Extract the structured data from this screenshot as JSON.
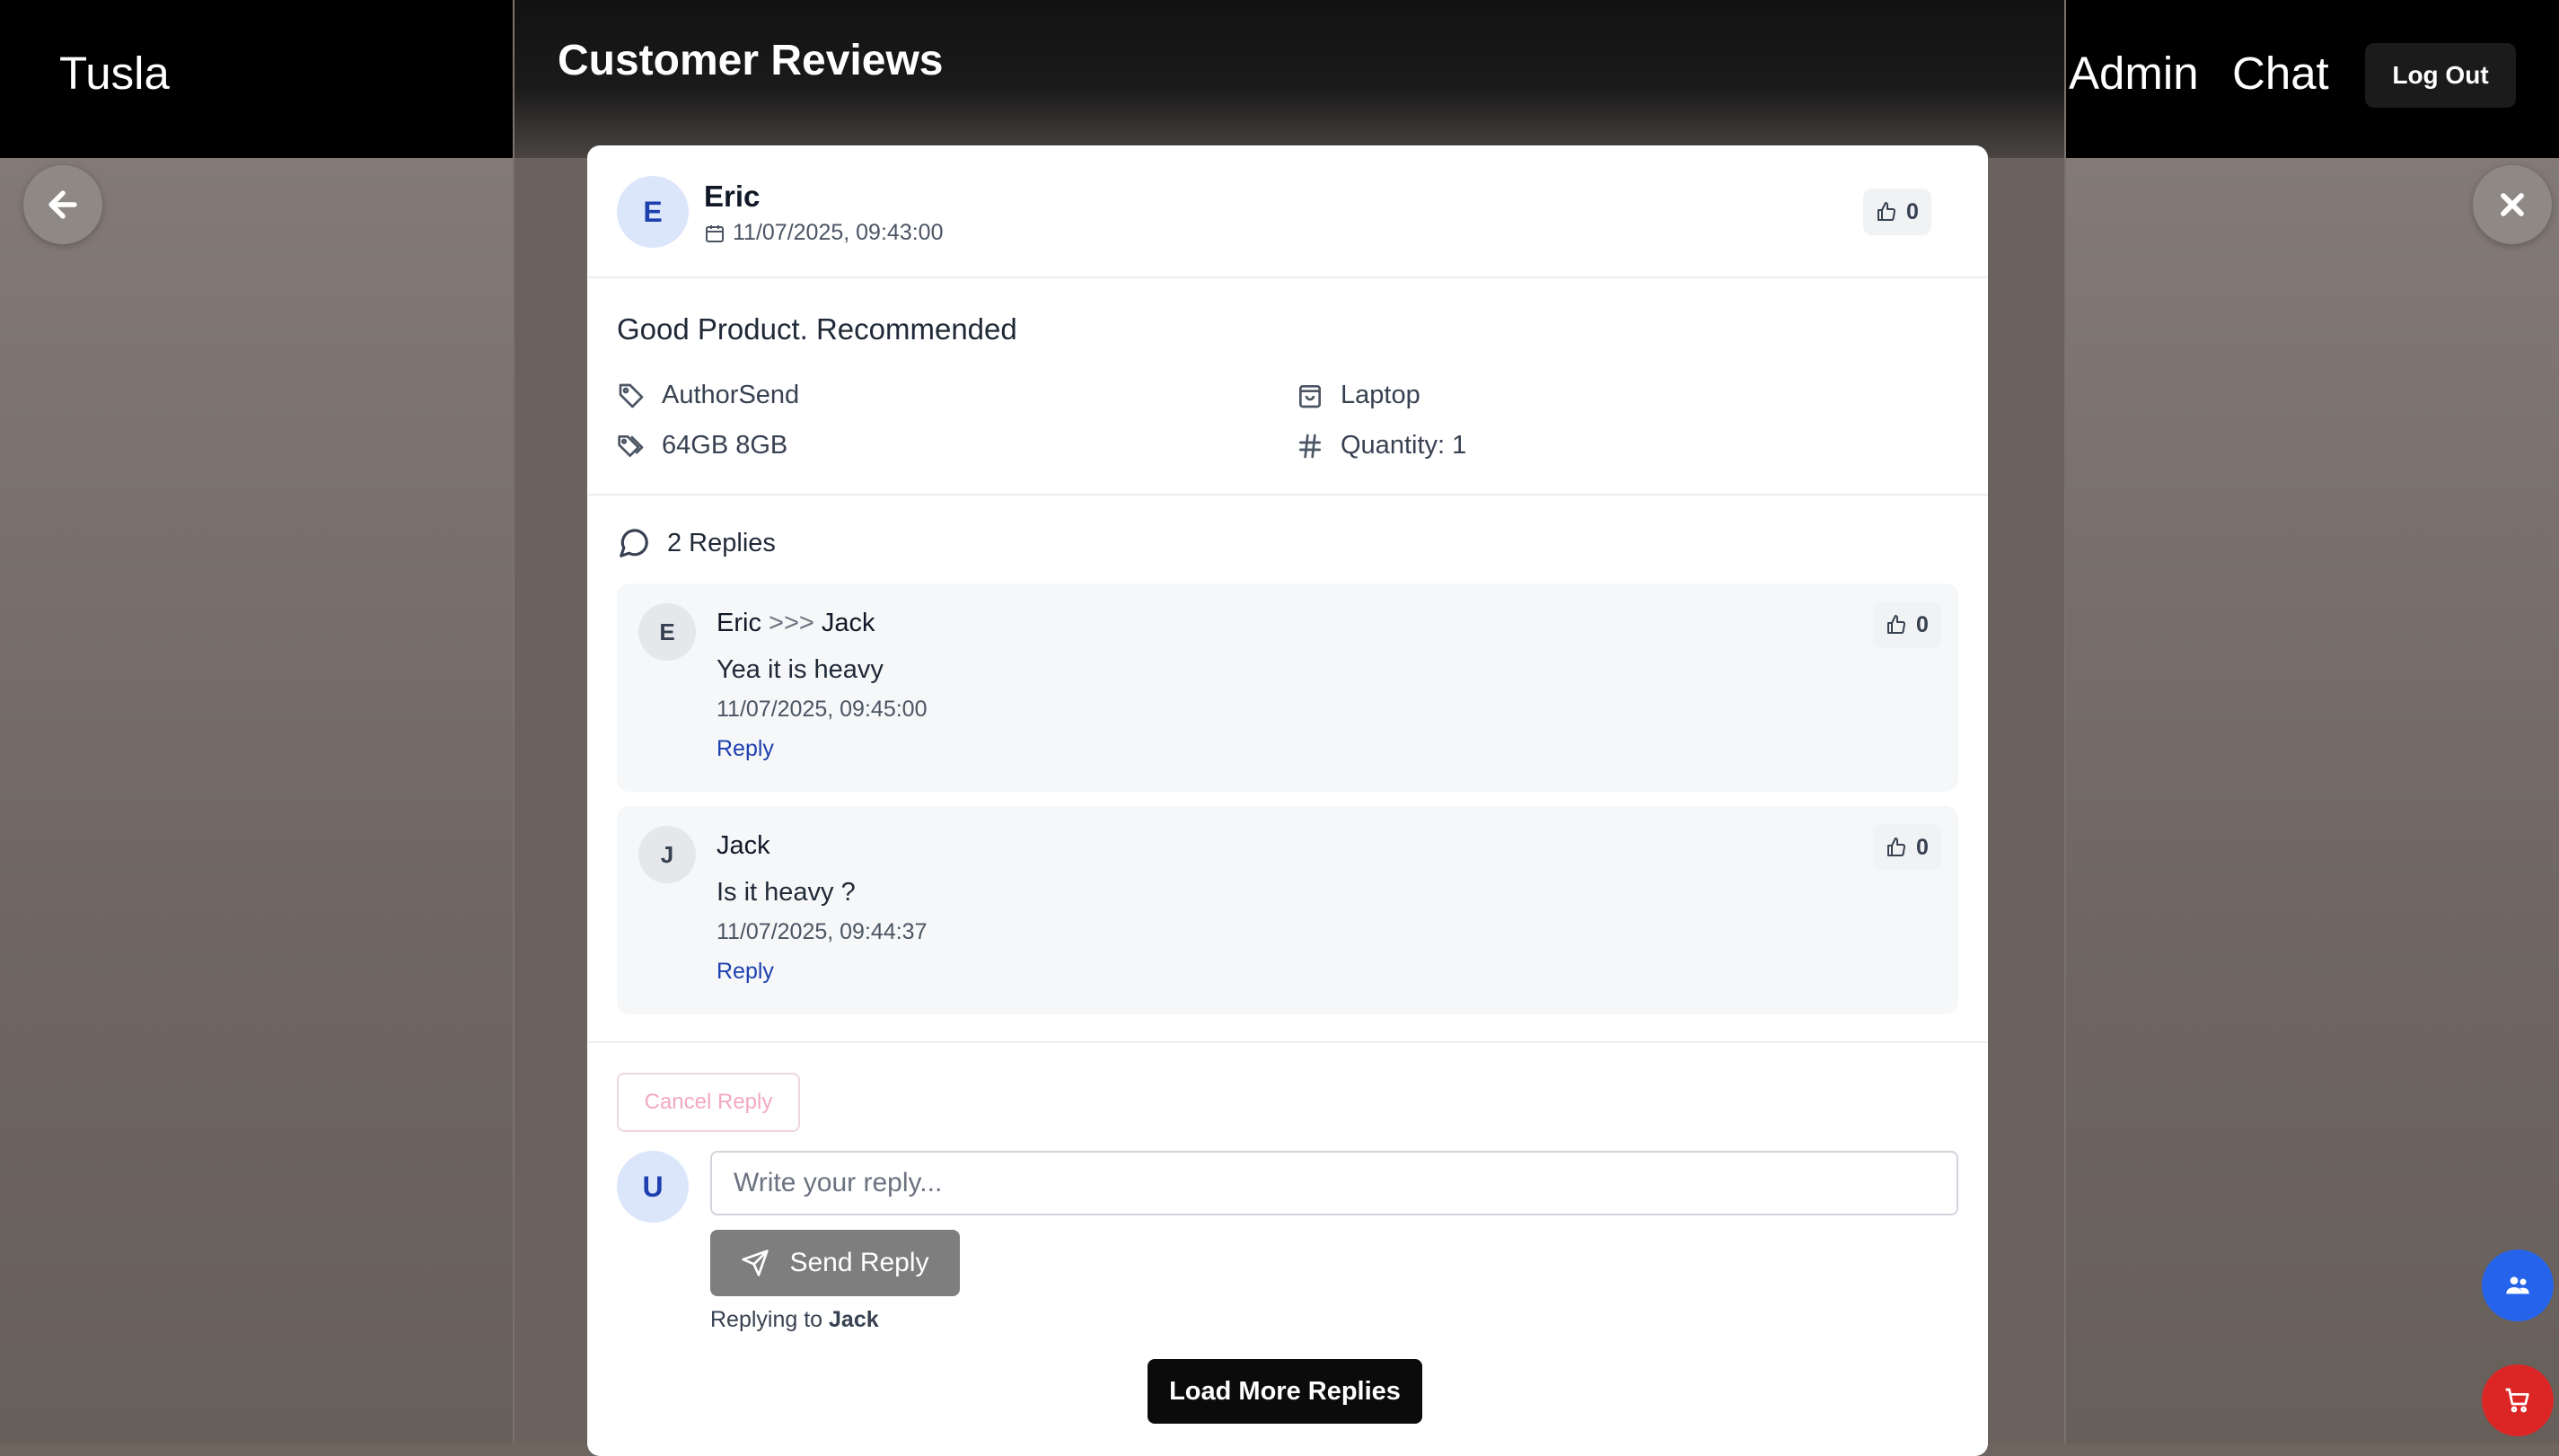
{
  "nav": {
    "brand": "Tusla",
    "admin": "Admin",
    "chat": "Chat",
    "logout": "Log Out"
  },
  "modal": {
    "title": "Customer Reviews"
  },
  "review": {
    "avatar_initial": "E",
    "author": "Eric",
    "date": "11/07/2025, 09:43:00",
    "likes": "0",
    "text": "Good Product. Recommended",
    "brand": "AuthorSend",
    "category": "Laptop",
    "variant": "64GB 8GB",
    "quantity": "Quantity: 1"
  },
  "replies": {
    "count_label": "2 Replies",
    "items": [
      {
        "initial": "E",
        "author": "Eric",
        "separator": ">>>",
        "target": "Jack",
        "text": "Yea it is heavy",
        "date": "11/07/2025, 09:45:00",
        "likes": "0",
        "reply_label": "Reply"
      },
      {
        "initial": "J",
        "author": "Jack",
        "text": "Is it heavy ?",
        "date": "11/07/2025, 09:44:37",
        "likes": "0",
        "reply_label": "Reply"
      }
    ]
  },
  "compose": {
    "cancel_label": "Cancel Reply",
    "user_initial": "U",
    "placeholder": "Write your reply...",
    "send_label": "Send Reply",
    "replying_prefix": "Replying to",
    "replying_to": "Jack"
  },
  "load_more_label": "Load More Replies",
  "colors": {
    "accent_blue": "#1e40af",
    "fab_blue": "#2563eb",
    "fab_red": "#dc2626"
  }
}
